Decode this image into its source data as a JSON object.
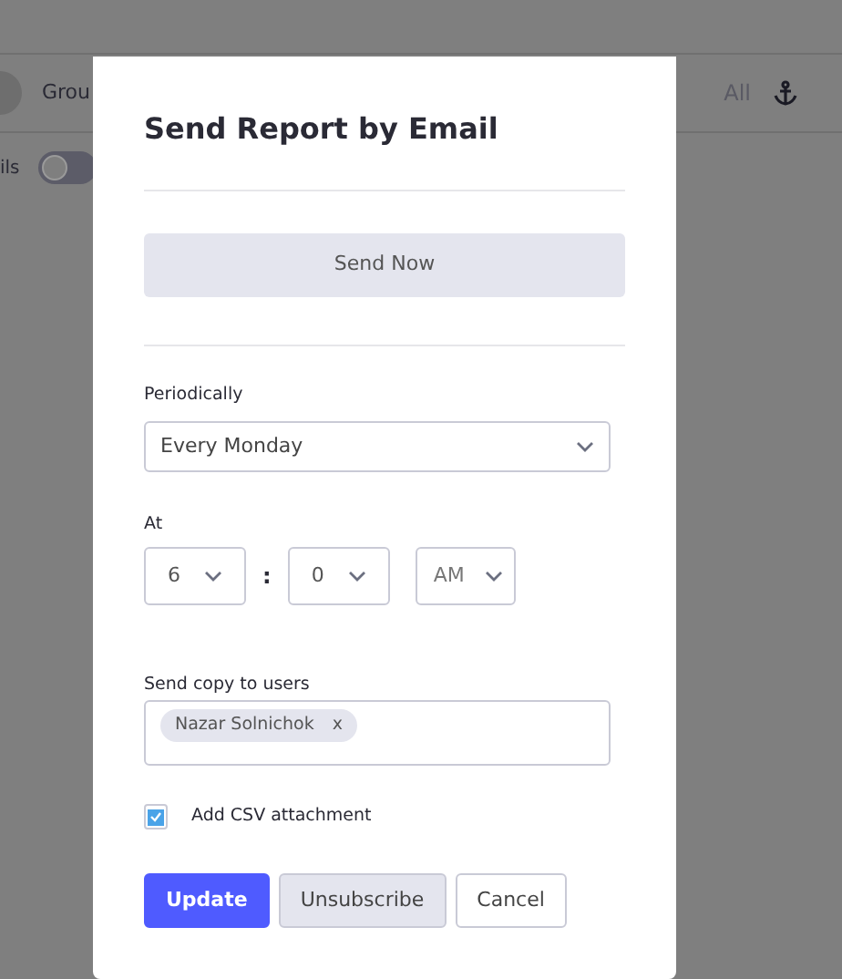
{
  "background": {
    "group_label": "Grou",
    "right_label": "All",
    "toggle_label": "ils",
    "toggle": {
      "on": false
    }
  },
  "dialog": {
    "title": "Send Report by Email",
    "send_now": "Send Now",
    "periodically": {
      "label": "Periodically",
      "value": "Every Monday"
    },
    "at": {
      "label": "At",
      "hour": "6",
      "separator": ":",
      "minute": "0",
      "period": "AM"
    },
    "copy": {
      "label": "Send copy to users",
      "users": [
        {
          "name": "Nazar Solnichok",
          "remove": "x"
        }
      ]
    },
    "csv": {
      "label": "Add CSV attachment",
      "checked": true
    },
    "buttons": [
      {
        "kind": "primary",
        "label": "Update"
      },
      {
        "kind": "secondary",
        "label": "Unsubscribe"
      },
      {
        "kind": "outline",
        "label": "Cancel"
      }
    ]
  }
}
